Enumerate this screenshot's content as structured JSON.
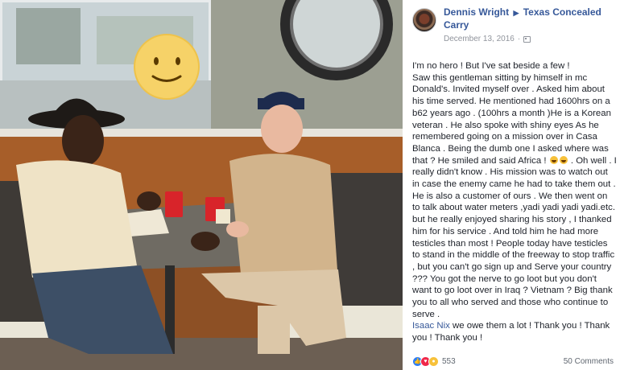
{
  "post": {
    "author": "Dennis Wright",
    "page": "Texas Concealed Carry",
    "date": "December 13, 2016",
    "paragraph_1": "I'm no hero ! But I've sat beside a few !",
    "paragraph_2a": "Saw this gentleman sitting by himself in mc Donald's. Invited myself over . Asked him about his time served. He mentioned had 1600hrs on a b62 years ago . (100hrs a month )He is a Korean veteran . He also spoke with shiny eyes As he remembered going on a mission over in Casa Blanca . Being the dumb one I asked where was that ? He smiled and said Africa !",
    "paragraph_2b": ". Oh well . I really didn't know . His mission was to watch out in case the enemy came he had to take them out . He is also a customer of ours . We then went on to talk about water meters ,yadi yadi yadi yadi.etc. but he really enjoyed sharing his story , I thanked him for his service . And told him he had more testicles than most ! People today have testicles to stand in the middle of the freeway to stop traffic , but you can't go sign up and Serve your country ??? You got the nerve to go loot but you don't want to go loot over in Iraq ? Vietnam ? Big thank you to all who served and those who continue to serve .",
    "mention": "Isaac Nix",
    "paragraph_3": "we owe them a lot ! Thank you ! Thank you ! Thank you !"
  },
  "footer": {
    "reaction_count": "553",
    "comments_label": "50 Comments"
  },
  "icons": {
    "audience": "group-icon",
    "reactions": [
      "like-icon",
      "love-icon",
      "wow-icon"
    ],
    "emoji": [
      "laughing-emoji",
      "laughing-emoji"
    ]
  },
  "colors": {
    "link": "#365899",
    "text": "#1d2129",
    "muted": "#90949c",
    "like": "#2e7ef5",
    "love": "#f0284a",
    "wow": "#f7c13a"
  }
}
